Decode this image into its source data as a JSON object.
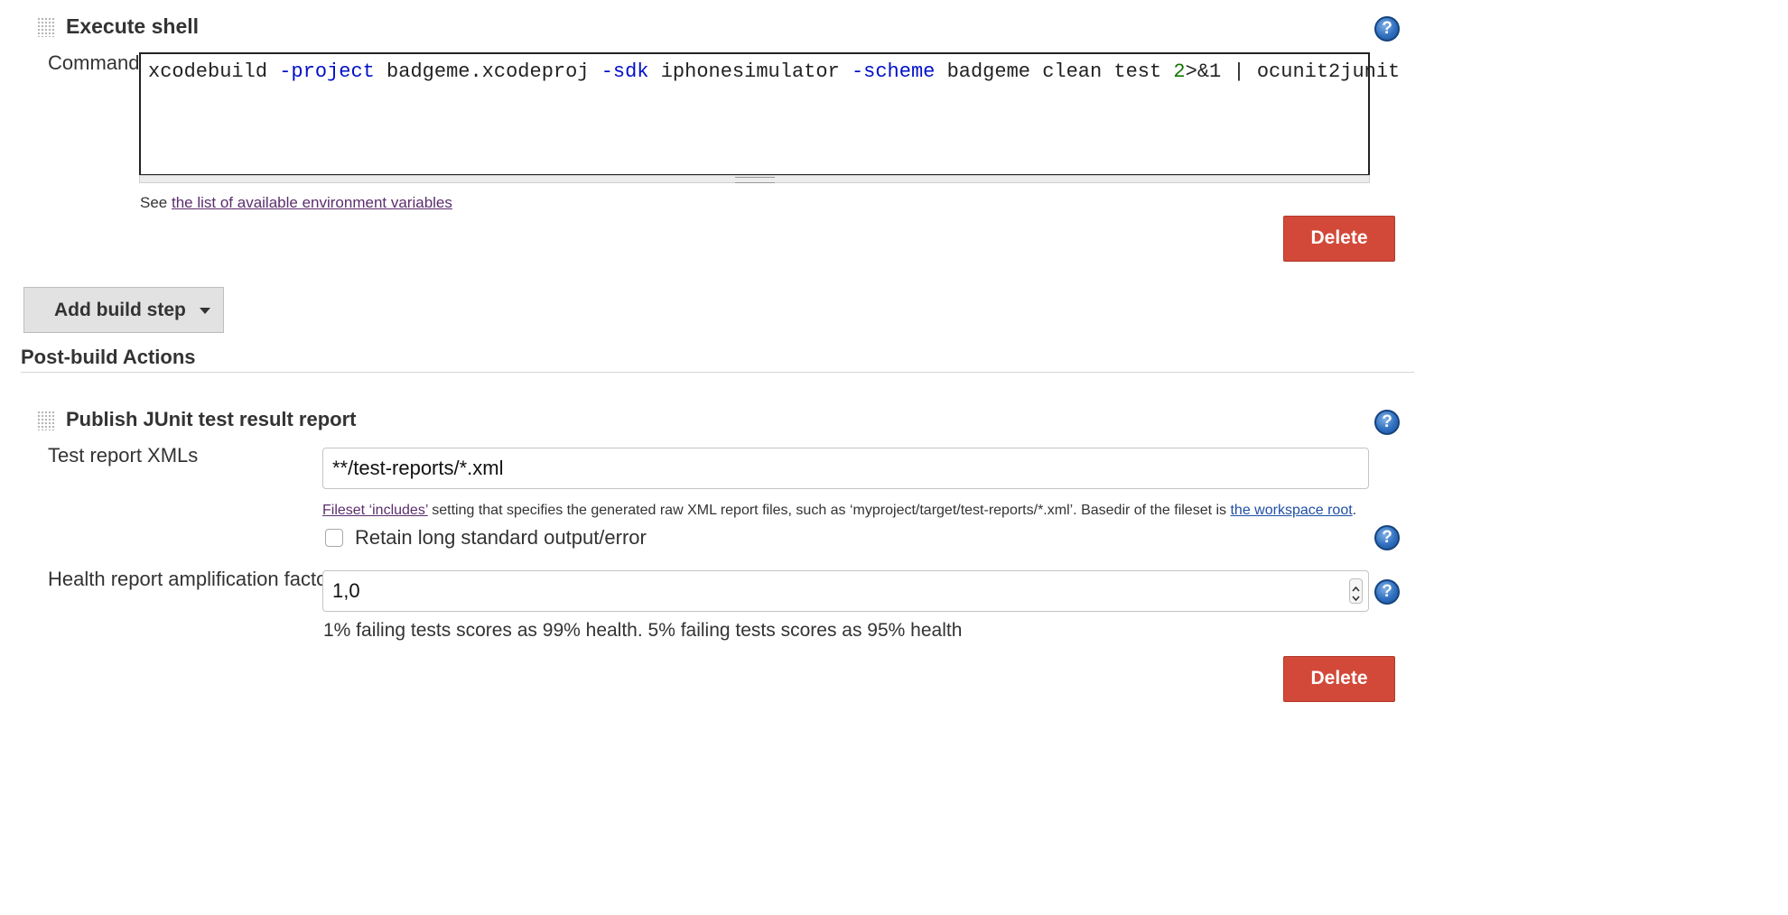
{
  "execute_shell": {
    "title": "Execute shell",
    "command_label": "Command",
    "command": {
      "p1": "xcodebuild ",
      "p2": "-project",
      "p3": " badgeme.xcodeproj ",
      "p4": "-sdk",
      "p5": " iphonesimulator ",
      "p6": "-scheme",
      "p7": " badgeme clean test ",
      "p8": "2",
      "p9": ">&1 | ocunit2junit"
    },
    "env_hint_prefix": "See ",
    "env_hint_link": "the list of available environment variables",
    "delete_label": "Delete"
  },
  "add_build_step": {
    "label": "Add build step"
  },
  "post_build": {
    "heading": "Post-build Actions"
  },
  "junit": {
    "title": "Publish JUnit test result report",
    "test_report_label": "Test report XMLs",
    "test_report_value": "**/test-reports/*.xml",
    "hint_link1": "Fileset ‘includes’",
    "hint_middle": " setting that specifies the generated raw XML report files, such as ‘myproject/target/test-reports/*.xml’. Basedir of the fileset is ",
    "hint_link2": "the workspace root",
    "hint_end": ".",
    "retain_label": "Retain long standard output/error",
    "retain_checked": false,
    "health_label": "Health report amplification factor",
    "health_value": "1,0",
    "health_hint": "1% failing tests scores as 99% health. 5% failing tests scores as 95% health",
    "delete_label": "Delete"
  },
  "icons": {
    "help": "help-icon",
    "drag": "drag-handle-icon",
    "dropdown": "caret-down-icon"
  },
  "colors": {
    "delete_button": "#d24939",
    "help_icon": "#2f6fbf",
    "keyword": "#0010c8",
    "number": "#117700",
    "link": "#1f4fa6",
    "visited_link": "#5b2d6e"
  }
}
